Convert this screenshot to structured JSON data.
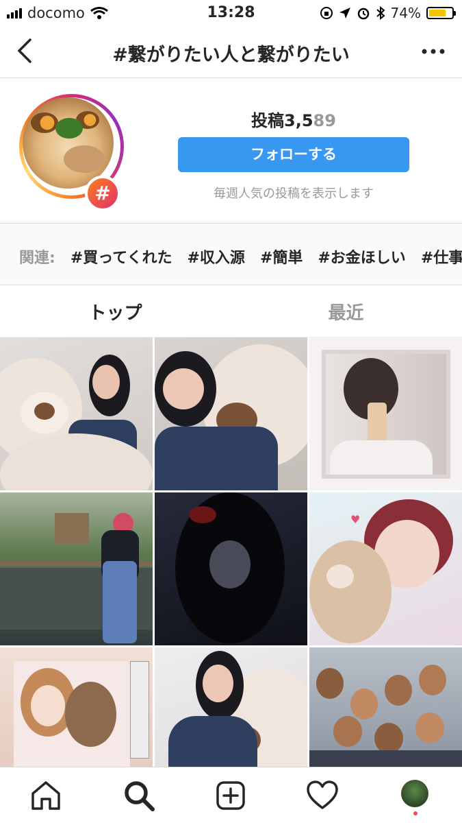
{
  "status_bar": {
    "carrier": "docomo",
    "time": "13:28",
    "battery": "74%",
    "battery_level": 0.74,
    "icons": [
      "signal-icon",
      "wifi-icon",
      "orientation-lock-icon",
      "location-icon",
      "alarm-icon",
      "bluetooth-icon",
      "battery-icon"
    ]
  },
  "nav": {
    "title": "#繋がりたい人と繋がりたい",
    "back_icon": "chevron-left-icon",
    "more_icon": "ellipsis-icon"
  },
  "header": {
    "post_count_label": "投稿3,5",
    "post_count_faded": "89",
    "follow_label": "フォローする",
    "weekly_text": "毎週人気の投稿を表示します",
    "badge_symbol": "#"
  },
  "related": {
    "label": "関連:",
    "tags": [
      "#買ってくれた",
      "#収入源",
      "#簡単",
      "#お金ほしい",
      "#仕事"
    ]
  },
  "tabs": {
    "top": "トップ",
    "recent": "最近"
  },
  "grid": {
    "cells": [
      {
        "id": "post-1",
        "bg": "#d8d4d2"
      },
      {
        "id": "post-2",
        "bg": "#cfcac6"
      },
      {
        "id": "post-3",
        "bg": "#f3eef0"
      },
      {
        "id": "post-4",
        "bg": "#7d8a70"
      },
      {
        "id": "post-5",
        "bg": "#1a1c28"
      },
      {
        "id": "post-6",
        "bg": "#e8dfe6"
      },
      {
        "id": "post-7",
        "bg": "#e7cfc7"
      },
      {
        "id": "post-8",
        "bg": "#e4e2e8"
      },
      {
        "id": "post-9",
        "bg": "#9aa4b4"
      }
    ]
  },
  "tab_bar": {
    "items": [
      "home-icon",
      "search-icon",
      "add-post-icon",
      "heart-icon",
      "profile-avatar"
    ]
  },
  "colors": {
    "accent": "#3897f0",
    "text": "#262626",
    "muted": "#999999",
    "badge_start": "#fa7e1e",
    "badge_end": "#e1306c"
  }
}
